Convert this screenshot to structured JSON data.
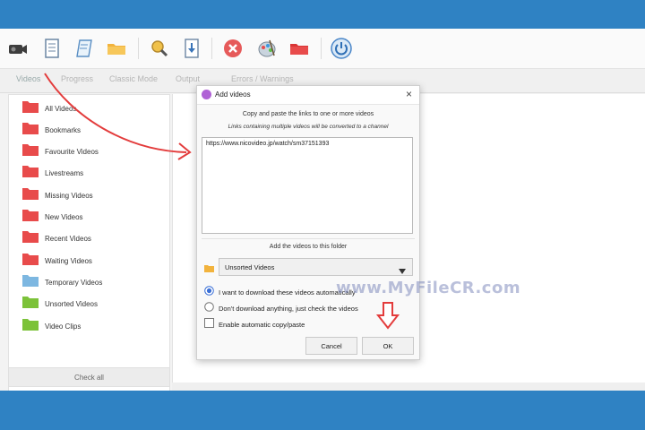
{
  "toolbar": {
    "icons": [
      "camera-icon",
      "notebook-icon",
      "document-icon",
      "folder-icon",
      "search-icon",
      "download-icon",
      "stop-icon",
      "palette-icon",
      "red-folder-icon",
      "power-icon"
    ]
  },
  "tabs": [
    {
      "label": "Videos"
    },
    {
      "label": "Progress"
    },
    {
      "label": "Classic Mode"
    },
    {
      "label": "Output"
    },
    {
      "label": "Errors / Warnings"
    }
  ],
  "sidebar": {
    "items": [
      {
        "label": "All Videos",
        "color": "#e84b4b"
      },
      {
        "label": "Bookmarks",
        "color": "#e84b4b"
      },
      {
        "label": "Favourite Videos",
        "color": "#e84b4b"
      },
      {
        "label": "Livestreams",
        "color": "#e84b4b"
      },
      {
        "label": "Missing Videos",
        "color": "#e84b4b"
      },
      {
        "label": "New Videos",
        "color": "#e84b4b"
      },
      {
        "label": "Recent Videos",
        "color": "#e84b4b"
      },
      {
        "label": "Waiting Videos",
        "color": "#e84b4b"
      },
      {
        "label": "Temporary Videos",
        "color": "#7db7e0"
      },
      {
        "label": "Unsorted Videos",
        "color": "#7cc23a"
      },
      {
        "label": "Video Clips",
        "color": "#7cc23a"
      }
    ],
    "check_all": "Check all"
  },
  "dialog": {
    "title": "Add videos",
    "line1": "Copy and paste the links to one or more videos",
    "line2": "Links containing multiple videos will be converted to a channel",
    "url": "https://www.nicovideo.jp/watch/sm37151393",
    "folder_caption": "Add the videos to this folder",
    "folder_value": "Unsorted Videos",
    "option1": "I want to download these videos automatically",
    "option2": "Don't download anything, just check the videos",
    "option3": "Enable automatic copy/paste",
    "cancel": "Cancel",
    "ok": "OK"
  },
  "watermark": "www.MyFileCR.com",
  "colors": {
    "outer": "#2f82c3",
    "accent": "#3a6fd6",
    "arrow": "#e33c3c"
  }
}
